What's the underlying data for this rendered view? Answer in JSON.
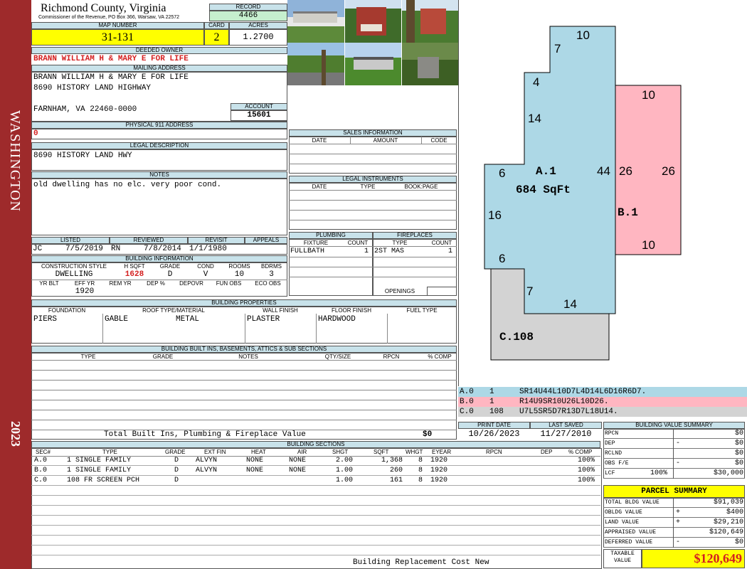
{
  "sidebar": {
    "district": "WASHINGTON",
    "year": "2023"
  },
  "header": {
    "county": "Richmond County, Virginia",
    "address_line": "Commissioner of the Revenue, PO Box 366, Warsaw, VA 22572",
    "record_label": "RECORD",
    "record": "4466",
    "map_number_label": "MAP NUMBER",
    "map_number": "31-131",
    "card_label": "CARD",
    "card": "2",
    "acres_label": "ACRES",
    "acres": "1.2700"
  },
  "owner": {
    "deeded_owner_label": "DEEDED OWNER",
    "deeded_owner": "BRANN WILLIAM H & MARY E FOR LIFE",
    "mailing_label": "MAILING ADDRESS",
    "mailing_line1": "BRANN WILLIAM H & MARY E FOR LIFE",
    "mailing_line2": "8690 HISTORY LAND HIGHWAY",
    "mailing_line3": "FARNHAM, VA 22460-0000",
    "account_label": "ACCOUNT",
    "account": "15601",
    "physical_label": "PHYSICAL 911 ADDRESS",
    "physical": "0",
    "legal_label": "LEGAL DESCRIPTION",
    "legal": "8690 HISTORY LAND HWY",
    "notes_label": "NOTES",
    "notes": "old dwelling has no elc. very poor cond."
  },
  "sales": {
    "title": "SALES INFORMATION",
    "cols": [
      "DATE",
      "AMOUNT",
      "CODE"
    ]
  },
  "legal_instruments": {
    "title": "LEGAL INSTRUMENTS",
    "cols": [
      "DATE",
      "TYPE",
      "BOOK:PAGE"
    ]
  },
  "plumbing": {
    "title": "PLUMBING",
    "col_fixture": "FIXTURE",
    "col_count": "COUNT",
    "fixture": "FULLBATH",
    "count": "1"
  },
  "fireplaces": {
    "title": "FIREPLACES",
    "col_type": "TYPE",
    "col_count": "COUNT",
    "type": "2ST MAS",
    "count": "1",
    "openings_label": "OPENINGS"
  },
  "listing": {
    "listed_label": "LISTED",
    "listed_by": "JC",
    "listed_date": "7/5/2019",
    "reviewed_label": "REVIEWED",
    "reviewed_by": "RN",
    "reviewed_date": "7/8/2014",
    "revisit_label": "REVISIT",
    "revisit": "1/1/1980",
    "appeals_label": "APPEALS"
  },
  "building_info": {
    "title": "BUILDING INFORMATION",
    "cols": [
      "CONSTRUCTION STYLE",
      "H SQFT",
      "GRADE",
      "COND",
      "ROOMS",
      "BDRMS"
    ],
    "style": "DWELLING",
    "hsqft": "1628",
    "grade": "D",
    "cond": "V",
    "rooms": "10",
    "bdrms": "3",
    "cols2": [
      "YR BLT",
      "EFF YR",
      "REM YR",
      "DEP %",
      "DEPOVR",
      "FUN OBS",
      "ECO OBS"
    ],
    "eff_yr": "1920"
  },
  "properties": {
    "title": "BUILDING PROPERTIES",
    "cols": [
      "FOUNDATION",
      "ROOF TYPE/MATERIAL",
      "WALL FINISH",
      "FLOOR FINISH",
      "FUEL TYPE"
    ],
    "foundation": "PIERS",
    "roof_type": "GABLE",
    "roof_material": "METAL",
    "wall": "PLASTER",
    "floor": "HARDWOOD"
  },
  "builtins": {
    "title": "BUILDING BUILT INS, BASEMENTS, ATTICS & SUB SECTIONS",
    "cols": [
      "TYPE",
      "GRADE",
      "NOTES",
      "QTY/SIZE",
      "RPCN",
      "% COMP"
    ],
    "total_label": "Total Built Ins, Plumbing & Fireplace Value",
    "total": "$0"
  },
  "sketch": {
    "area_a_label": "A.1",
    "area_a_sqft": "684 SqFt",
    "area_b_label": "B.1",
    "area_c_label": "C.108",
    "dims": [
      "10",
      "7",
      "4",
      "14",
      "6",
      "16",
      "6",
      "7",
      "14",
      "44",
      "10",
      "26",
      "26",
      "10"
    ],
    "codes": [
      {
        "sec": "A.0",
        "num": "1",
        "code": "SR14U44L10D7L4D14L6D16R6D7."
      },
      {
        "sec": "B.0",
        "num": "1",
        "code": "R14U9SR10U26L10D26."
      },
      {
        "sec": "C.0",
        "num": "108",
        "code": "U7L5SR5D7R13D7L18U14."
      }
    ]
  },
  "dates": {
    "print_label": "PRINT DATE",
    "print": "10/26/2023",
    "saved_label": "LAST SAVED",
    "saved": "11/27/2010"
  },
  "sections": {
    "title": "BUILDING SECTIONS",
    "cols": [
      "SEC#",
      "TYPE",
      "GRADE",
      "EXT FIN",
      "HEAT",
      "AIR",
      "SHGT",
      "SQFT",
      "WHGT",
      "EYEAR",
      "RPCN",
      "DEP",
      "% COMP"
    ],
    "rows": [
      {
        "sec": "A.0",
        "type": "1 SINGLE FAMILY",
        "grade": "D",
        "ext": "ALVYN",
        "heat": "NONE",
        "air": "NONE",
        "shgt": "2.00",
        "sqft": "1,368",
        "whgt": "8",
        "eyear": "1920",
        "comp": "100%"
      },
      {
        "sec": "B.0",
        "type": "1 SINGLE FAMILY",
        "grade": "D",
        "ext": "ALVYN",
        "heat": "NONE",
        "air": "NONE",
        "shgt": "1.00",
        "sqft": "260",
        "whgt": "8",
        "eyear": "1920",
        "comp": "100%"
      },
      {
        "sec": "C.0",
        "type": "108 FR SCREEN PCH",
        "grade": "D",
        "ext": "",
        "heat": "",
        "air": "",
        "shgt": "1.00",
        "sqft": "161",
        "whgt": "8",
        "eyear": "1920",
        "comp": "100%"
      }
    ],
    "footer": "Building Replacement Cost New"
  },
  "value_summary": {
    "title": "BUILDING VALUE SUMMARY",
    "rpcn_label": "RPCN",
    "rpcn": "$0",
    "dep_label": "DEP",
    "dep_sign": "-",
    "dep": "$0",
    "rclnd_label": "RCLND",
    "rclnd": "$0",
    "obs_label": "OBS F/E",
    "obs_sign": "-",
    "obs": "$0",
    "lcf_label": "LCF",
    "lcf_pct": "100%",
    "lcf": "$30,000"
  },
  "parcel": {
    "title": "PARCEL SUMMARY",
    "bldg_label": "TOTAL BLDG VALUE",
    "bldg": "$91,039",
    "obldg_label": "OBLDG VALUE",
    "obldg_sign": "+",
    "obldg": "$400",
    "land_label": "LAND VALUE",
    "land_sign": "+",
    "land": "$29,210",
    "appraised_label": "APPRAISED VALUE",
    "appraised": "$120,649",
    "deferred_label": "DEFERRED VALUE",
    "deferred_sign": "-",
    "deferred": "$0",
    "taxable_label1": "TAXABLE",
    "taxable_label2": "VALUE",
    "taxable": "$120,649"
  },
  "colors": {
    "sidebar": "#9e2a2b",
    "header_blue": "#c8e2ea",
    "highlight_yellow": "#ffff00",
    "record_green": "#c6efce",
    "area_a": "#add8e6",
    "area_b": "#ffb6c1",
    "area_c": "#d3d3d3"
  }
}
